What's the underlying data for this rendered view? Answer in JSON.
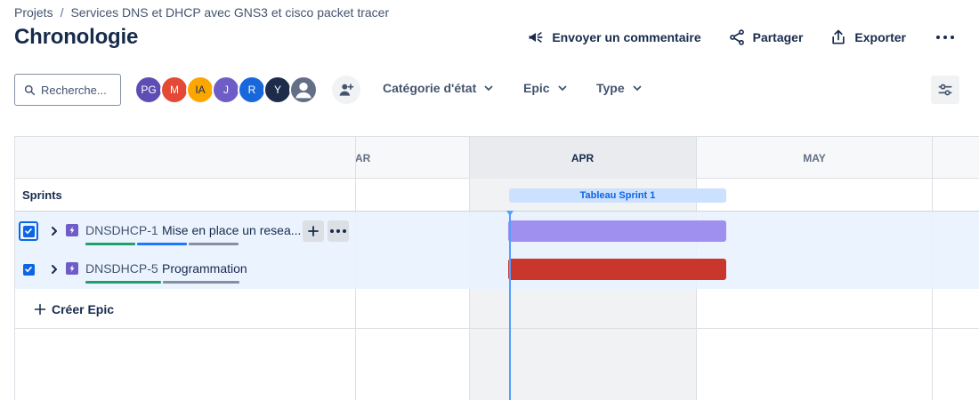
{
  "breadcrumb": {
    "items": [
      "Projets",
      "Services DNS et DHCP avec GNS3 et cisco packet tracer"
    ],
    "separator": "/"
  },
  "page": {
    "title": "Chronologie"
  },
  "header_actions": {
    "feedback": {
      "label": "Envoyer un commentaire",
      "icon": "megaphone-icon"
    },
    "share": {
      "label": "Partager",
      "icon": "share-icon"
    },
    "export": {
      "label": "Exporter",
      "icon": "export-icon"
    },
    "more": {
      "icon": "more-icon"
    }
  },
  "filters": {
    "search_placeholder": "Recherche...",
    "avatars": [
      {
        "initials": "PG",
        "color": "#5e4db2"
      },
      {
        "initials": "M",
        "color": "#e34935"
      },
      {
        "initials": "IA",
        "color": "#fca700"
      },
      {
        "initials": "J",
        "color": "#6e5dc6"
      },
      {
        "initials": "R",
        "color": "#1868db"
      },
      {
        "initials": "Y",
        "color": "#1e2b4a"
      },
      {
        "initials": "",
        "color": "#626f86"
      }
    ],
    "status_category": "Catégorie d'état",
    "epic": "Epic",
    "type": "Type"
  },
  "timeline": {
    "months": [
      "AR",
      "APR",
      "MAY"
    ],
    "current_month": "APR",
    "sprints_label": "Sprints",
    "sprint": {
      "name": "Tableau Sprint 1"
    },
    "epics": [
      {
        "key": "DNSDHCP-1",
        "title": "Mise en place un resea...",
        "checked": true,
        "bar_color": "#9f8fef",
        "progress_colors": [
          "#22a06b",
          "#1d7afc",
          "#8590a2"
        ]
      },
      {
        "key": "DNSDHCP-5",
        "title": "Programmation",
        "checked": true,
        "bar_color": "#c9372c",
        "progress_colors": [
          "#22a06b",
          "#8590a2"
        ]
      }
    ],
    "create_epic_label": "Créer Epic"
  },
  "colors": {
    "accent": "#0c66e4",
    "today_line": "#579dff",
    "selected_row": "#e9f2ff"
  }
}
